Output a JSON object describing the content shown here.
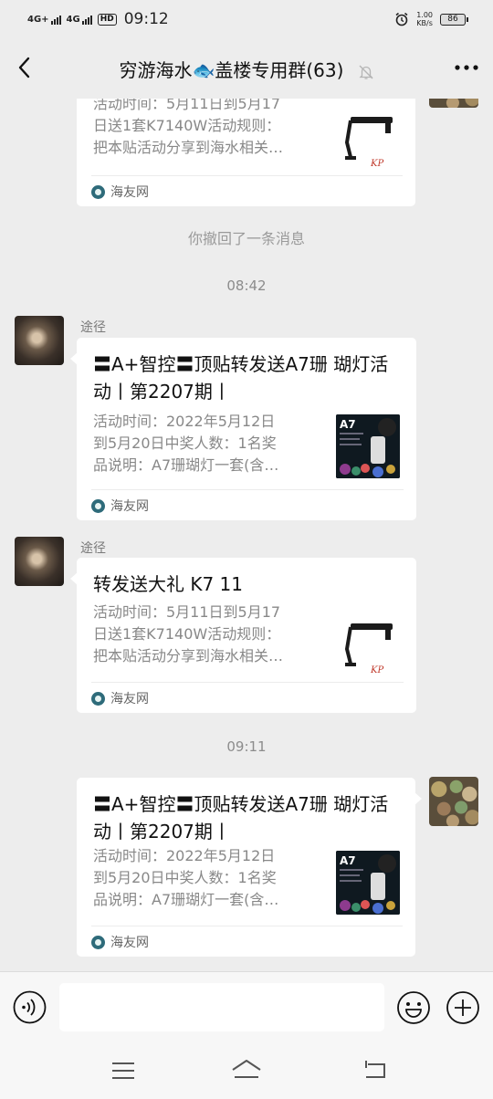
{
  "status_bar": {
    "net1": "4G+",
    "net2": "4G",
    "hd": "HD",
    "time": "09:12",
    "speed_value": "1.00",
    "speed_unit": "KB/s",
    "battery": "86"
  },
  "header": {
    "title": "穷游海水🐟盖楼专用群(63)"
  },
  "messages": [
    {
      "desc": "活动时间：5月11日到5月17\n日送1套K7140W活动规则：\n把本贴活动分享到海水相关…",
      "source": "海友网"
    },
    {
      "recall_text": "你撤回了一条消息"
    },
    {
      "time": "08:42"
    },
    {
      "sender": "途径",
      "title": "〓A+智控〓顶贴转发送A7珊 瑚灯活动丨第2207期丨",
      "desc": "活动时间：2022年5月12日\n到5月20日中奖人数：1名奖\n品说明：A7珊瑚灯一套(含…",
      "source": "海友网",
      "thumb_label": "A7"
    },
    {
      "sender": "途径",
      "title": "转发送大礼 K7 11",
      "desc": "活动时间：5月11日到5月17\n日送1套K7140W活动规则：\n把本贴活动分享到海水相关…",
      "source": "海友网",
      "thumb_logo": "KP"
    },
    {
      "time": "09:11"
    },
    {
      "title": "〓A+智控〓顶贴转发送A7珊 瑚灯活动丨第2207期丨",
      "desc": "活动时间：2022年5月12日\n到5月20日中奖人数：1名奖\n品说明：A7珊瑚灯一套(含…",
      "source": "海友网",
      "thumb_label": "A7"
    }
  ],
  "input": {
    "placeholder": ""
  },
  "icons": {
    "back": "chevron-left-icon",
    "mute": "bell-off-icon",
    "more": "more-dots-icon",
    "voice": "voice-icon",
    "emoji": "emoji-icon",
    "plus": "plus-icon",
    "sys_menu": "menu-icon",
    "sys_home": "home-icon",
    "sys_back": "back-icon"
  }
}
